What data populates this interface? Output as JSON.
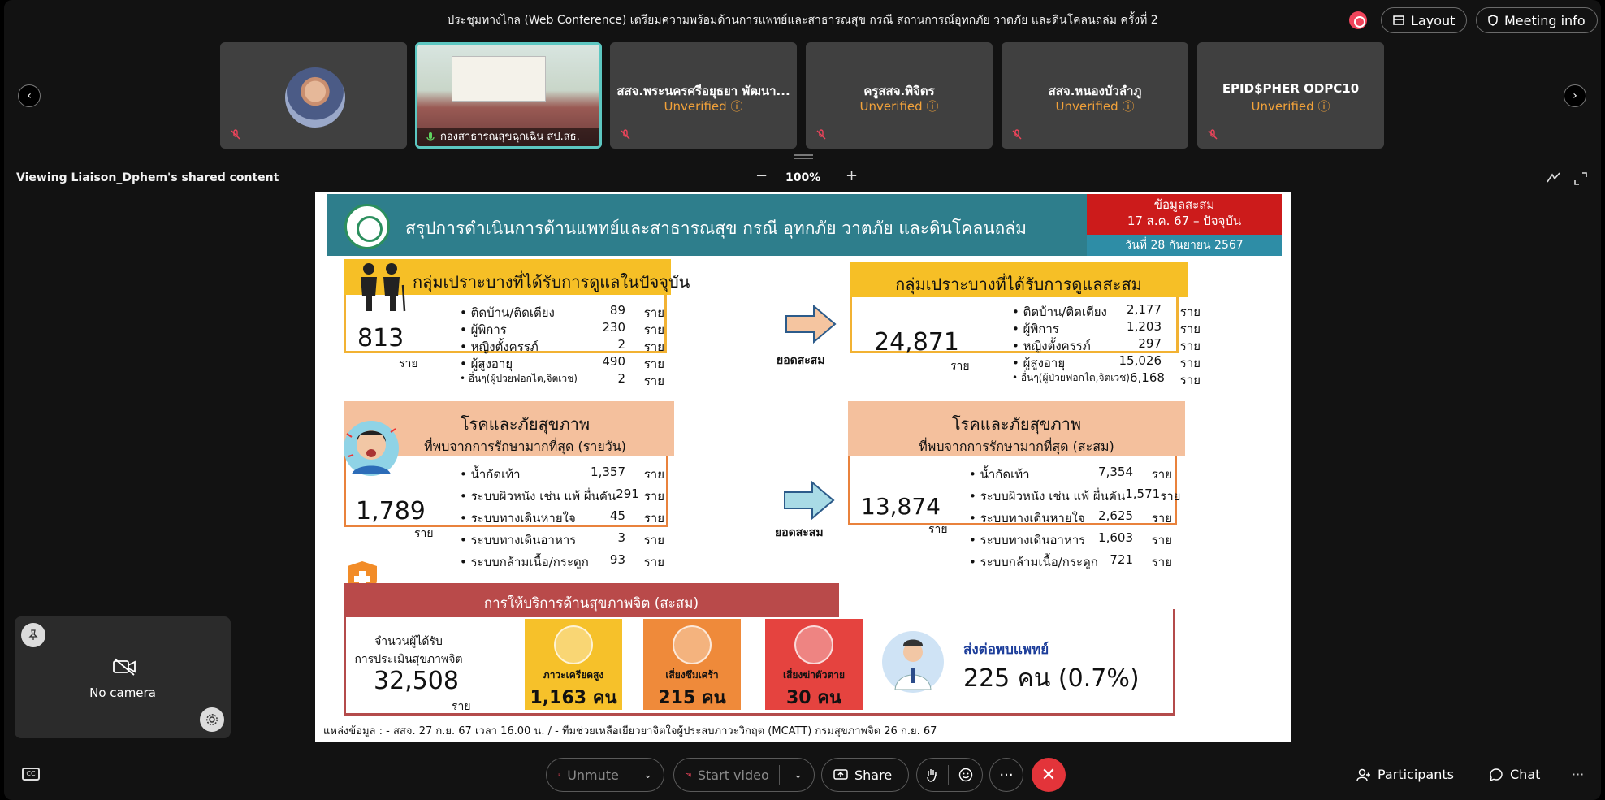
{
  "meeting": {
    "title": "ประชุมทางไกล (Web Conference) เตรียมความพร้อมด้านการแพทย์และสาธารณสุข กรณี สถานการณ์อุทกภัย วาตภัย และดินโคลนถล่ม ครั้งที่ 2",
    "layout_label": "Layout",
    "meeting_info_label": "Meeting info",
    "accent_color": "#f0445b"
  },
  "participants_strip": {
    "tiles": [
      {
        "name": "",
        "status": "",
        "kind": "avatar"
      },
      {
        "name": "กองสาธารณสุขฉุกเฉิน สป.สธ.",
        "status": "",
        "kind": "video"
      },
      {
        "name": "สสจ.พระนครศรีอยุธยา พัฒนา...",
        "status": "Unverified"
      },
      {
        "name": "ครูสสจ.พิจิตร",
        "status": "Unverified"
      },
      {
        "name": "สสจ.หนองบัวลำภู",
        "status": "Unverified"
      },
      {
        "name": "EPID$PHER ODPC10",
        "status": "Unverified"
      }
    ]
  },
  "share": {
    "viewing_label": "Viewing Liaison_Dphem's shared content",
    "zoom": "100%",
    "zoom_minus": "−",
    "zoom_plus": "+"
  },
  "slide": {
    "title": "สรุปการดำเนินการด้านแพทย์และสาธารณสุข กรณี อุทกภัย วาตภัย และดินโคลนถล่ม",
    "cum_line1": "ข้อมูลสะสม",
    "cum_line2": "17 ส.ค. 67 – ปัจจุบัน",
    "date": "วันที่ 28 กันยายน 2567",
    "vuln_today": {
      "title": "กลุ่มเปราะบางที่ได้รับการดูแลในปัจจุบัน",
      "total": "813",
      "unit": "ราย",
      "items": [
        {
          "label": "ติดบ้าน/ติดเตียง",
          "value": "89",
          "unit": "ราย"
        },
        {
          "label": "ผู้พิการ",
          "value": "230",
          "unit": "ราย"
        },
        {
          "label": "หญิงตั้งครรภ์",
          "value": "2",
          "unit": "ราย"
        },
        {
          "label": "ผู้สูงอายุ",
          "value": "490",
          "unit": "ราย"
        },
        {
          "label": "อื่นๆ(ผู้ป่วยฟอกไต,จิตเวช)",
          "value": "2",
          "unit": "ราย"
        }
      ]
    },
    "vuln_cum": {
      "title": "กลุ่มเปราะบางที่ได้รับการดูแลสะสม",
      "total": "24,871",
      "unit": "ราย",
      "items": [
        {
          "label": "ติดบ้าน/ติดเตียง",
          "value": "2,177",
          "unit": "ราย"
        },
        {
          "label": "ผู้พิการ",
          "value": "1,203",
          "unit": "ราย"
        },
        {
          "label": "หญิงตั้งครรภ์",
          "value": "297",
          "unit": "ราย"
        },
        {
          "label": "ผู้สูงอายุ",
          "value": "15,026",
          "unit": "ราย"
        },
        {
          "label": "อื่นๆ(ผู้ป่วยฟอกไต,จิตเวช)",
          "value": "6,168",
          "unit": "ราย"
        }
      ]
    },
    "arrow_label": "ยอดสะสม",
    "disease_today": {
      "title": "โรคและภัยสุขภาพ",
      "subtitle": "ที่พบจากการรักษามากที่สุด (รายวัน)",
      "total": "1,789",
      "unit": "ราย",
      "items": [
        {
          "label": "น้ำกัดเท้า",
          "value": "1,357",
          "unit": "ราย"
        },
        {
          "label": "ระบบผิวหนัง เช่น แพ้ ผื่นคัน",
          "value": "291",
          "unit": "ราย"
        },
        {
          "label": "ระบบทางเดินหายใจ",
          "value": "45",
          "unit": "ราย"
        },
        {
          "label": "ระบบทางเดินอาหาร",
          "value": "3",
          "unit": "ราย"
        },
        {
          "label": "ระบบกล้ามเนื้อ/กระดูก",
          "value": "93",
          "unit": "ราย"
        }
      ]
    },
    "disease_cum": {
      "title": "โรคและภัยสุขภาพ",
      "subtitle": "ที่พบจากการรักษามากที่สุด (สะสม)",
      "total": "13,874",
      "unit": "ราย",
      "items": [
        {
          "label": "น้ำกัดเท้า",
          "value": "7,354",
          "unit": "ราย"
        },
        {
          "label": "ระบบผิวหนัง เช่น แพ้ ผื่นคัน",
          "value": "1,571",
          "unit": "ราย"
        },
        {
          "label": "ระบบทางเดินหายใจ",
          "value": "2,625",
          "unit": "ราย"
        },
        {
          "label": "ระบบทางเดินอาหาร",
          "value": "1,603",
          "unit": "ราย"
        },
        {
          "label": "ระบบกล้ามเนื้อ/กระดูก",
          "value": "721",
          "unit": "ราย"
        }
      ]
    },
    "mental": {
      "title": "การให้บริการด้านสุขภาพจิต (สะสม)",
      "assessed_line1": "จำนวนผู้ได้รับ",
      "assessed_line2": "การประเมินสุขภาพจิต",
      "assessed_total": "32,508",
      "assessed_unit": "ราย",
      "cards": [
        {
          "label": "ภาวะเครียดสูง",
          "value": "1,163 คน",
          "color": "#f6c12a"
        },
        {
          "label": "เสี่ยงซึมเศร้า",
          "value": "215 คน",
          "color": "#ef8a3a"
        },
        {
          "label": "เสี่ยงฆ่าตัวตาย",
          "value": "30 คน",
          "color": "#e5433f"
        }
      ],
      "refer_label": "ส่งต่อพบแพทย์",
      "refer_value": "225 คน (0.7%)"
    },
    "source": "แหล่งข้อมูล : - สสจ. 27 ก.ย. 67 เวลา 16.00 น. / - ทีมช่วยเหลือเยียวยาจิตใจผู้ประสบภาวะวิกฤต (MCATT) กรมสุขภาพจิต 26 ก.ย. 67"
  },
  "self_view": {
    "label": "No camera"
  },
  "toolbar": {
    "unmute": "Unmute",
    "start_video": "Start video",
    "share": "Share",
    "participants": "Participants",
    "chat": "Chat",
    "cc": "CC",
    "more": "···",
    "end_color": "#e3343a"
  }
}
